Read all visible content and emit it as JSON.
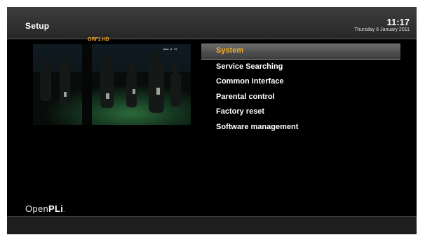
{
  "header": {
    "title": "Setup",
    "time": "11:17",
    "date": "Thursday 6 January 2011"
  },
  "preview": {
    "channel": "ORF1 HD",
    "badge": "ORF1 HD"
  },
  "menu": {
    "items": [
      {
        "label": "System",
        "selected": true
      },
      {
        "label": "Service Searching",
        "selected": false
      },
      {
        "label": "Common Interface",
        "selected": false
      },
      {
        "label": "Parental control",
        "selected": false
      },
      {
        "label": "Factory reset",
        "selected": false
      },
      {
        "label": "Software management",
        "selected": false
      }
    ]
  },
  "brand": {
    "logo_light": "Open",
    "logo_bold": "PLi",
    "logo_mark": "."
  },
  "colors": {
    "accent": "#f3b029",
    "background": "#000000",
    "header": "#333333"
  }
}
